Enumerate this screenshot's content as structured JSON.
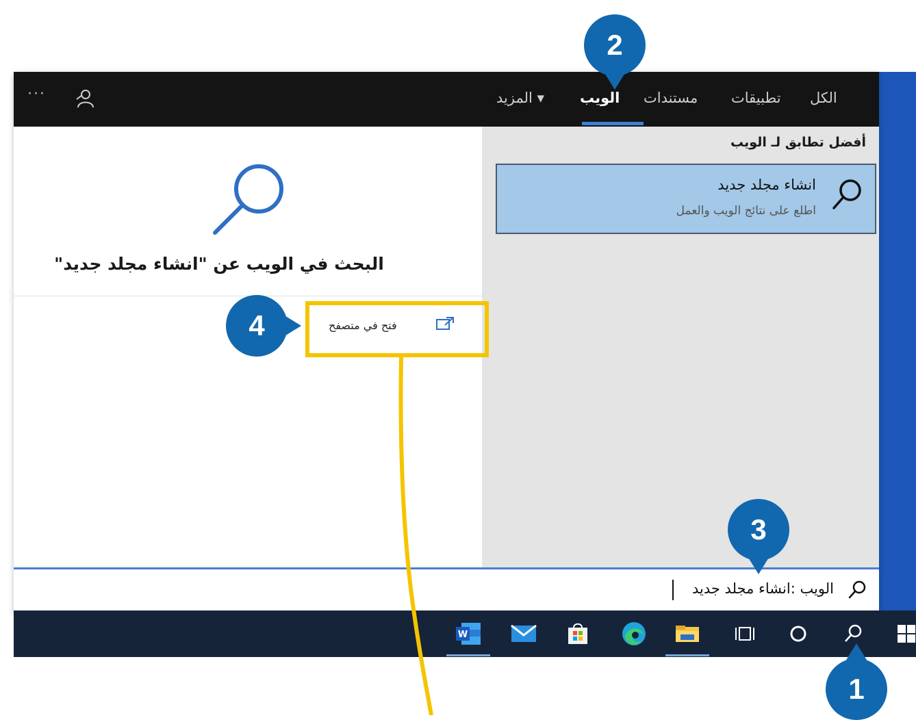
{
  "topbar": {
    "tabs": [
      {
        "label": "الكل"
      },
      {
        "label": "تطبيقات"
      },
      {
        "label": "مستندات"
      },
      {
        "label": "الويب"
      },
      {
        "label": "المزيد ▾"
      }
    ],
    "active_tab": "الويب",
    "overflow_label": "···",
    "feedback_icon": "feedback-icon"
  },
  "right_pane": {
    "section_label": "أفضل تطابق لـ الويب",
    "best_match": {
      "title": "انشاء مجلد جديد",
      "subtitle": "اطلع على نتائج الويب والعمل",
      "icon": "search-icon"
    }
  },
  "left_pane": {
    "title": "البحث في الويب عن \"انشاء مجلد جديد\"",
    "open_in_browser": "فتح في متصفح",
    "icon": "search-icon"
  },
  "search_box": {
    "value": "الويب :انشاء مجلد جديد",
    "icon": "search-icon"
  },
  "taskbar": {
    "items": [
      "start-icon",
      "search-icon",
      "cortana-icon",
      "task-view-icon",
      "file-explorer-icon",
      "edge-icon",
      "store-icon",
      "mail-icon",
      "word-icon"
    ]
  },
  "callouts": [
    "1",
    "2",
    "3",
    "4"
  ],
  "colors": {
    "callout": "#1268ae",
    "highlight": "#f5c400",
    "selected_result": "#a3c8e8",
    "topbar": "#141414",
    "taskbar": "#16243a"
  }
}
